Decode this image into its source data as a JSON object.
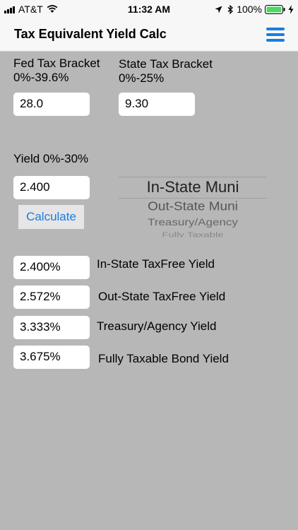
{
  "status": {
    "carrier": "AT&T",
    "time": "11:32 AM",
    "battery": "100%"
  },
  "nav": {
    "title": "Tax Equivalent Yield Calc"
  },
  "fed": {
    "label": "Fed Tax Bracket",
    "range": "0%-39.6%",
    "value": "28.0"
  },
  "state": {
    "label": "State Tax Bracket",
    "range": "0%-25%",
    "value": "9.30"
  },
  "yield": {
    "label": "Yield 0%-30%",
    "value": "2.400"
  },
  "calculate": {
    "label": "Calculate"
  },
  "picker": {
    "items": [
      "In-State Muni",
      "Out-State Muni",
      "Treasury/Agency",
      "Fully Taxable"
    ],
    "selected": "In-State Muni"
  },
  "results": [
    {
      "value": "2.400%",
      "label": "In-State TaxFree Yield"
    },
    {
      "value": "2.572%",
      "label": "Out-State TaxFree Yield"
    },
    {
      "value": "3.333%",
      "label": "Treasury/Agency Yield"
    },
    {
      "value": "3.675%",
      "label": "Fully Taxable Bond Yield"
    }
  ]
}
